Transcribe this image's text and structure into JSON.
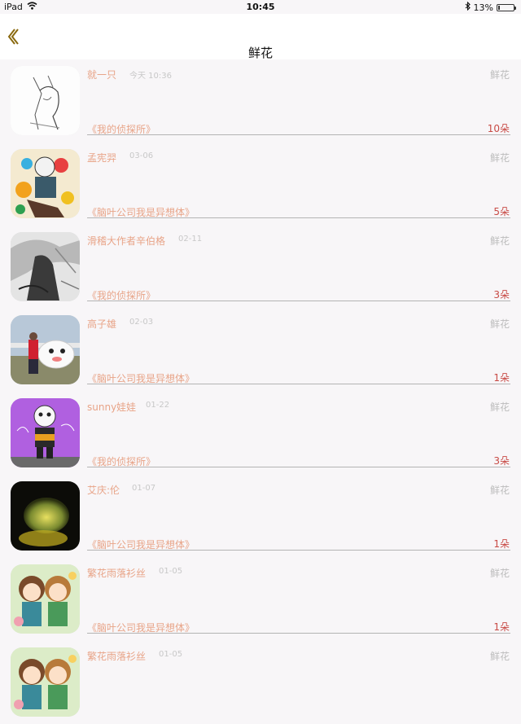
{
  "status_bar": {
    "device": "iPad",
    "time": "10:45",
    "battery_text": "13%",
    "battery_level": 0.13
  },
  "nav": {
    "title": "鲜花"
  },
  "items": [
    {
      "name": "就一只",
      "date": "今天 10:36",
      "type": "鲜花",
      "book": "《我的侦探所》",
      "count": "10朵"
    },
    {
      "name": "孟宪羿",
      "date": "03-06",
      "type": "鲜花",
      "book": "《脑叶公司我是异想体》",
      "count": "5朵"
    },
    {
      "name": "滑稽大作者辛伯格",
      "date": "02-11",
      "type": "鲜花",
      "book": "《我的侦探所》",
      "count": "3朵"
    },
    {
      "name": "高子雄",
      "date": "02-03",
      "type": "鲜花",
      "book": "《脑叶公司我是异想体》",
      "count": "1朵"
    },
    {
      "name": "sunny娃娃",
      "date": "01-22",
      "type": "鲜花",
      "book": "《我的侦探所》",
      "count": "3朵"
    },
    {
      "name": "艾庆:伦",
      "date": "01-07",
      "type": "鲜花",
      "book": "《脑叶公司我是异想体》",
      "count": "1朵"
    },
    {
      "name": "繁花雨落衫丝",
      "date": "01-05",
      "type": "鲜花",
      "book": "《脑叶公司我是异想体》",
      "count": "1朵"
    },
    {
      "name": "繁花雨落衫丝",
      "date": "01-05",
      "type": "鲜花",
      "book": "",
      "count": ""
    }
  ]
}
